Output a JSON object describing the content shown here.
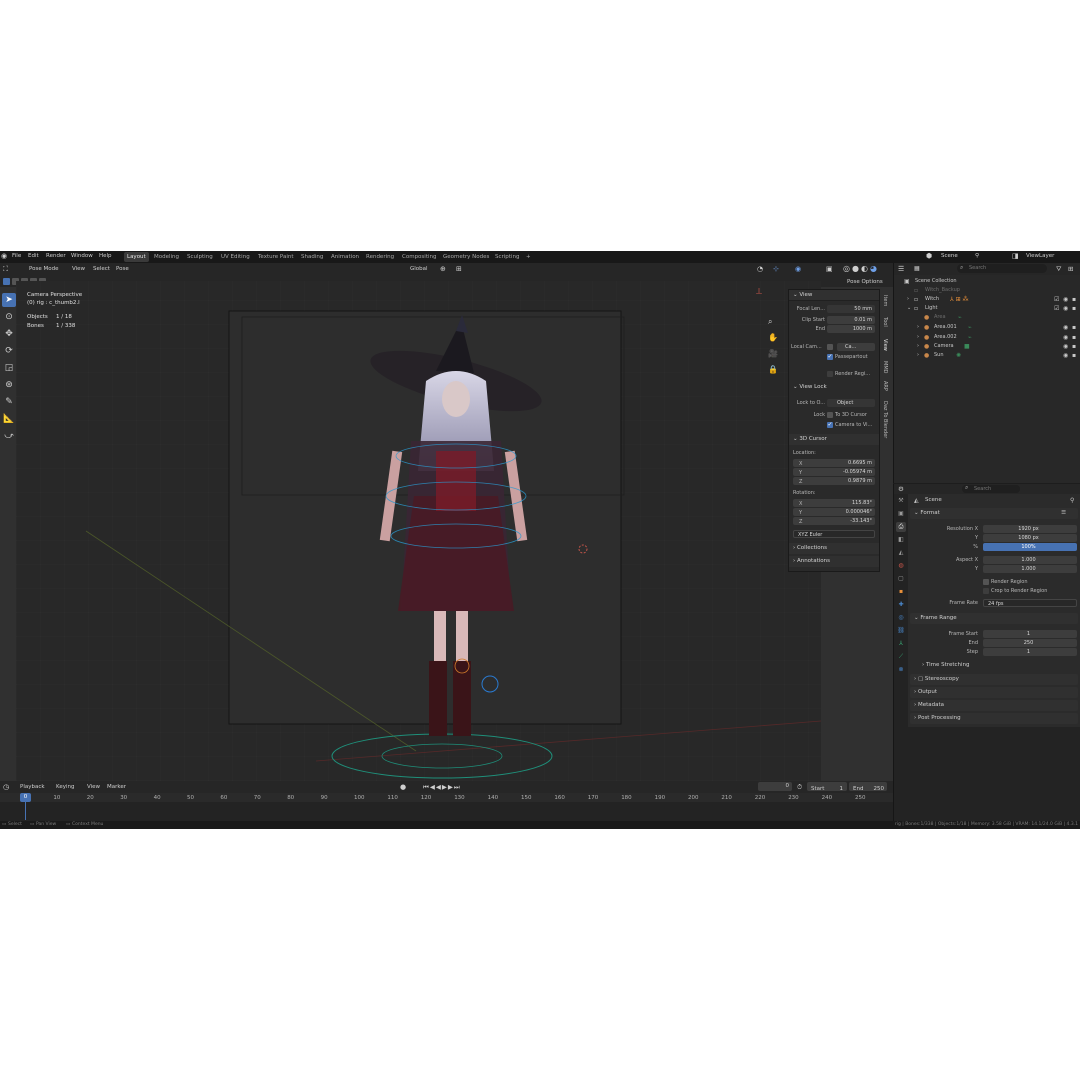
{
  "menu": [
    "File",
    "Edit",
    "Render",
    "Window",
    "Help"
  ],
  "workspaces": [
    "Layout",
    "Modeling",
    "Sculpting",
    "UV Editing",
    "Texture Paint",
    "Shading",
    "Animation",
    "Rendering",
    "Compositing",
    "Geometry Nodes",
    "Scripting",
    "+"
  ],
  "scene_name": "Scene",
  "view_layer": "ViewLayer",
  "viewport": {
    "mode": "Pose Mode",
    "menus": [
      "View",
      "Select",
      "Pose"
    ],
    "transform_space": "Global",
    "pose_options": "Pose Options",
    "overlay_title": "Camera Perspective",
    "overlay_sub": "(0) rig : c_thumb2.l",
    "stats": {
      "objects_label": "Objects",
      "objects": "1 / 18",
      "bones_label": "Bones",
      "bones": "1 / 338"
    }
  },
  "npanel": {
    "view_header": "View",
    "focal_label": "Focal Len...",
    "focal": "50 mm",
    "clip_start_label": "Clip Start",
    "clip_start": "0.01 m",
    "end_label": "End",
    "end": "1000 m",
    "local_cam_label": "Local Cam...",
    "local_cam_value": "Ca...",
    "passepartout": "Passepartout",
    "render_region": "Render Regi...",
    "view_lock_header": "View Lock",
    "lock_to_label": "Lock to O...",
    "lock_to_value": "Object",
    "lock_label": "Lock",
    "to_3d_cursor": "To 3D Cursor",
    "camera_to_view": "Camera to Vi...",
    "cursor_header": "3D Cursor",
    "location_label": "Location:",
    "loc": {
      "x": "0.6695 m",
      "y": "-0.05974 m",
      "z": "0.9879 m"
    },
    "rotation_label": "Rotation:",
    "rot": {
      "x": "115.83°",
      "y": "0.000046°",
      "z": "-33.143°"
    },
    "rotation_mode": "XYZ Euler",
    "collections": "Collections",
    "annotations": "Annotations",
    "tabs": [
      "Item",
      "Tool",
      "View",
      "MMD",
      "ARP",
      "Daz To Blender"
    ]
  },
  "timeline": {
    "menus": [
      "Playback",
      "Keying",
      "View",
      "Marker"
    ],
    "current_frame": "0",
    "start_label": "Start",
    "start": "1",
    "end_label": "End",
    "end": "250",
    "ticks": [
      "0",
      "10",
      "20",
      "30",
      "40",
      "50",
      "60",
      "70",
      "80",
      "90",
      "100",
      "110",
      "120",
      "130",
      "140",
      "150",
      "160",
      "170",
      "180",
      "190",
      "200",
      "210",
      "220",
      "230",
      "240",
      "250"
    ]
  },
  "outliner": {
    "search_placeholder": "Search",
    "items": [
      {
        "label": "Scene Collection"
      },
      {
        "label": "Witch_Backup"
      },
      {
        "label": "Witch"
      },
      {
        "label": "Light"
      },
      {
        "label": "Area"
      },
      {
        "label": "Area.001"
      },
      {
        "label": "Area.002"
      },
      {
        "label": "Camera"
      },
      {
        "label": "Sun"
      }
    ]
  },
  "properties": {
    "search_placeholder": "Search",
    "scene": "Scene",
    "format_header": "Format",
    "res_x_label": "Resolution X",
    "res_x": "1920 px",
    "res_y_label": "Y",
    "res_y": "1080 px",
    "pct_label": "%",
    "pct": "100%",
    "aspect_x_label": "Aspect X",
    "aspect_x": "1.000",
    "aspect_y_label": "Y",
    "aspect_y": "1.000",
    "render_region": "Render Region",
    "crop": "Crop to Render Region",
    "frame_rate_label": "Frame Rate",
    "frame_rate": "24 fps",
    "frame_range_header": "Frame Range",
    "frame_start_label": "Frame Start",
    "frame_start": "1",
    "frame_end_label": "End",
    "frame_end": "250",
    "step_label": "Step",
    "step": "1",
    "time_stretching": "Time Stretching",
    "stereoscopy": "Stereoscopy",
    "output": "Output",
    "metadata": "Metadata",
    "post_processing": "Post Processing"
  },
  "status": {
    "select": "Select",
    "pan_view": "Pan View",
    "context_menu": "Context Menu",
    "stats": "rig | Bones:1/338 | Objects:1/18 | Memory: 3.58 GiB | VRAM: 14.1/24.0 GiB | 4.3.1"
  }
}
